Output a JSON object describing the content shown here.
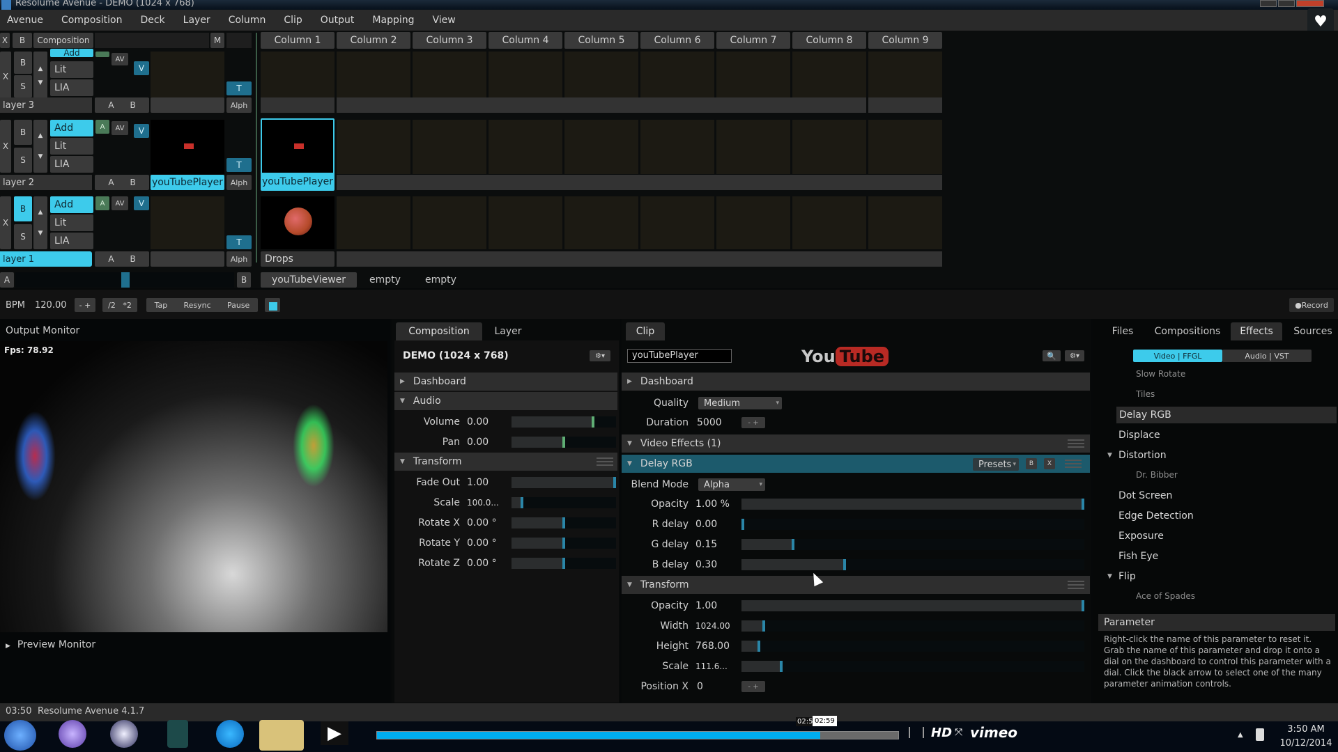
{
  "window": {
    "title": "Resolume Avenue - DEMO (1024 x 768)"
  },
  "menu": [
    "Avenue",
    "Composition",
    "Deck",
    "Layer",
    "Column",
    "Clip",
    "Output",
    "Mapping",
    "View"
  ],
  "side_icons": [
    "heart-icon",
    "clock-icon",
    "send-icon"
  ],
  "composition_bar": {
    "x_label": "X",
    "b_label": "B",
    "composition_label": "Composition",
    "m_label": "M"
  },
  "columns": [
    "Column 1",
    "Column 2",
    "Column 3",
    "Column 4",
    "Column 5",
    "Column 6",
    "Column 7",
    "Column 8",
    "Column 9"
  ],
  "layers": [
    {
      "name": "layer 3",
      "blend": "Add",
      "options": [
        "Lit",
        "LIA"
      ],
      "clips": [
        "",
        "",
        "",
        "",
        "",
        "",
        "",
        "",
        ""
      ],
      "deck_clip": ""
    },
    {
      "name": "layer 2",
      "blend": "Add",
      "options": [
        "Lit",
        "LIA"
      ],
      "deck_clip": "youTubePlayer",
      "clips": [
        "youTubePlayer",
        "",
        "",
        "",
        "",
        "",
        "",
        "",
        ""
      ]
    },
    {
      "name": "layer 1",
      "blend": "Add",
      "options": [
        "Lit",
        "LIA"
      ],
      "deck_clip": "",
      "clips": [
        "Drops",
        "",
        "",
        "",
        "",
        "",
        "",
        "",
        ""
      ]
    }
  ],
  "layer_buttons": {
    "x": "X",
    "b": "B",
    "s": "S",
    "a": "A",
    "av": "AV",
    "v": "V",
    "t": "T",
    "alph": "Alph",
    "a2": "A",
    "b2": "B"
  },
  "crossfader": {
    "a_label": "A",
    "b_label": "B",
    "position": 0.5
  },
  "decks": [
    "youTubeViewer",
    "empty",
    "empty"
  ],
  "transport": {
    "bpm_label": "BPM",
    "bpm_value": "120.00",
    "minus_plus": "- +",
    "half": "/2",
    "double": "*2",
    "tap": "Tap",
    "resync": "Resync",
    "pause": "Pause",
    "record": "Record"
  },
  "output_monitor": {
    "title": "Output Monitor",
    "fps": "Fps: 78.92",
    "preview_label": "Preview Monitor"
  },
  "composition_panel": {
    "tabs": [
      "Composition",
      "Layer"
    ],
    "active_tab": "Composition",
    "title": "DEMO (1024 x 768)",
    "sections": {
      "dashboard": "Dashboard",
      "audio": "Audio",
      "transform": "Transform"
    },
    "audio_params": [
      {
        "label": "Volume",
        "value": "0.00",
        "level": 0.78
      },
      {
        "label": "Pan",
        "value": "0.00",
        "level": 0.5
      }
    ],
    "transform_params": [
      {
        "label": "Fade Out",
        "value": "1.00",
        "level": 1.0
      },
      {
        "label": "Scale",
        "value": "100.0...",
        "level": 0.1
      },
      {
        "label": "Rotate X",
        "value": "0.00 °",
        "level": 0.5
      },
      {
        "label": "Rotate Y",
        "value": "0.00 °",
        "level": 0.5
      },
      {
        "label": "Rotate Z",
        "value": "0.00 °",
        "level": 0.5
      }
    ]
  },
  "clip_panel": {
    "tab": "Clip",
    "name_field": "youTubePlayer",
    "logo_you": "You",
    "logo_tube": "Tube",
    "sections": {
      "dashboard": "Dashboard",
      "video_effects": "Video Effects (1)",
      "delay_rgb": "Delay RGB",
      "transform": "Transform"
    },
    "quality_label": "Quality",
    "quality_value": "Medium",
    "duration_label": "Duration",
    "duration_value": "5000",
    "presets_label": "Presets",
    "effect_b": "B",
    "effect_x": "X",
    "blend_mode_label": "Blend Mode",
    "blend_mode_value": "Alpha",
    "delay_params": [
      {
        "label": "Opacity",
        "value": "1.00 %",
        "level": 1.0
      },
      {
        "label": "R delay",
        "value": "0.00",
        "level": 0.0
      },
      {
        "label": "G delay",
        "value": "0.15",
        "level": 0.15
      },
      {
        "label": "B delay",
        "value": "0.30",
        "level": 0.3
      }
    ],
    "transform_params": [
      {
        "label": "Opacity",
        "value": "1.00",
        "level": 1.0
      },
      {
        "label": "Width",
        "value": "1024.00",
        "level": 0.065
      },
      {
        "label": "Height",
        "value": "768.00",
        "level": 0.05
      },
      {
        "label": "Scale",
        "value": "111.6...",
        "level": 0.115
      }
    ],
    "position_x_label": "Position X",
    "position_x_value": "0"
  },
  "browser": {
    "tabs": [
      "Files",
      "Compositions",
      "Effects",
      "Sources"
    ],
    "active_tab": "Effects",
    "subtabs": [
      "Video | FFGL",
      "Audio | VST"
    ],
    "active_subtab": "Video | FFGL",
    "items": [
      {
        "label": "Slow Rotate",
        "type": "sub"
      },
      {
        "label": "Tiles",
        "type": "sub"
      },
      {
        "label": "Delay RGB",
        "type": "item",
        "selected": true
      },
      {
        "label": "Displace",
        "type": "item"
      },
      {
        "label": "Distortion",
        "type": "group"
      },
      {
        "label": "Dr. Bibber",
        "type": "sub"
      },
      {
        "label": "Dot Screen",
        "type": "item"
      },
      {
        "label": "Edge Detection",
        "type": "item"
      },
      {
        "label": "Exposure",
        "type": "item"
      },
      {
        "label": "Fish Eye",
        "type": "item"
      },
      {
        "label": "Flip",
        "type": "group"
      },
      {
        "label": "Ace of Spades",
        "type": "sub"
      }
    ],
    "parameter_title": "Parameter",
    "parameter_help": "Right-click the name of this parameter to reset it. Grab the name of this parameter and drop it onto a dial on the dashboard to control this parameter with a dial. Click the black arrow to select one of the many parameter animation controls."
  },
  "statusbar": {
    "time": "03:50",
    "version": "Resolume Avenue 4.1.7"
  },
  "video_player": {
    "progress": 0.85,
    "tooltip_time": "02:59",
    "tooltip_partial": "02:5",
    "hd_label": "HD",
    "brand": "vimeo"
  },
  "taskbar": {
    "clock_time": "3:50 AM",
    "clock_date": "10/12/2014"
  }
}
